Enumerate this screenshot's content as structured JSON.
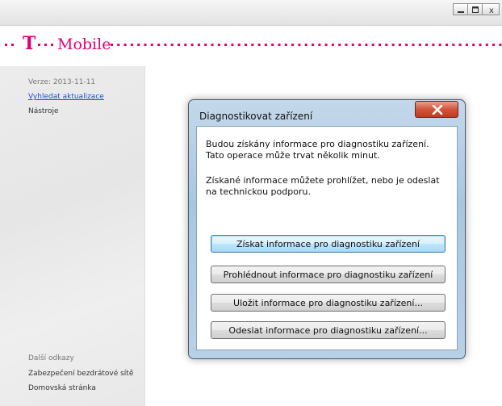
{
  "window": {
    "controls": [
      "minimize",
      "maximize",
      "close"
    ],
    "close_label": "x"
  },
  "brand": {
    "logo_text": "T",
    "name": "Mobile",
    "accent_color": "#e20074"
  },
  "sidebar": {
    "version": "Verze: 2013-11-11",
    "update_link": "Vyhledat aktualizace",
    "tools": "Nástroje",
    "more_links_heading": "Další odkazy",
    "links": [
      "Zabezpečení bezdrátové sítě",
      "Domovská stránka"
    ]
  },
  "dialog": {
    "title": "Diagnostikovat zařízení",
    "close_icon": "close-icon",
    "paragraph1_line1": "Budou získány informace pro diagnostiku zařízení.",
    "paragraph1_line2": "Tato operace může trvat několik minut.",
    "paragraph2_line1": "Získané informace můžete prohlížet, nebo je odeslat",
    "paragraph2_line2": "na technickou podporu.",
    "buttons": [
      "Získat informace pro diagnostiku zařízení",
      "Prohlédnout informace pro diagnostiku zařízení",
      "Uložit informace pro diagnostiku zařízení...",
      "Odeslat informace pro diagnostiku zařízení..."
    ]
  }
}
